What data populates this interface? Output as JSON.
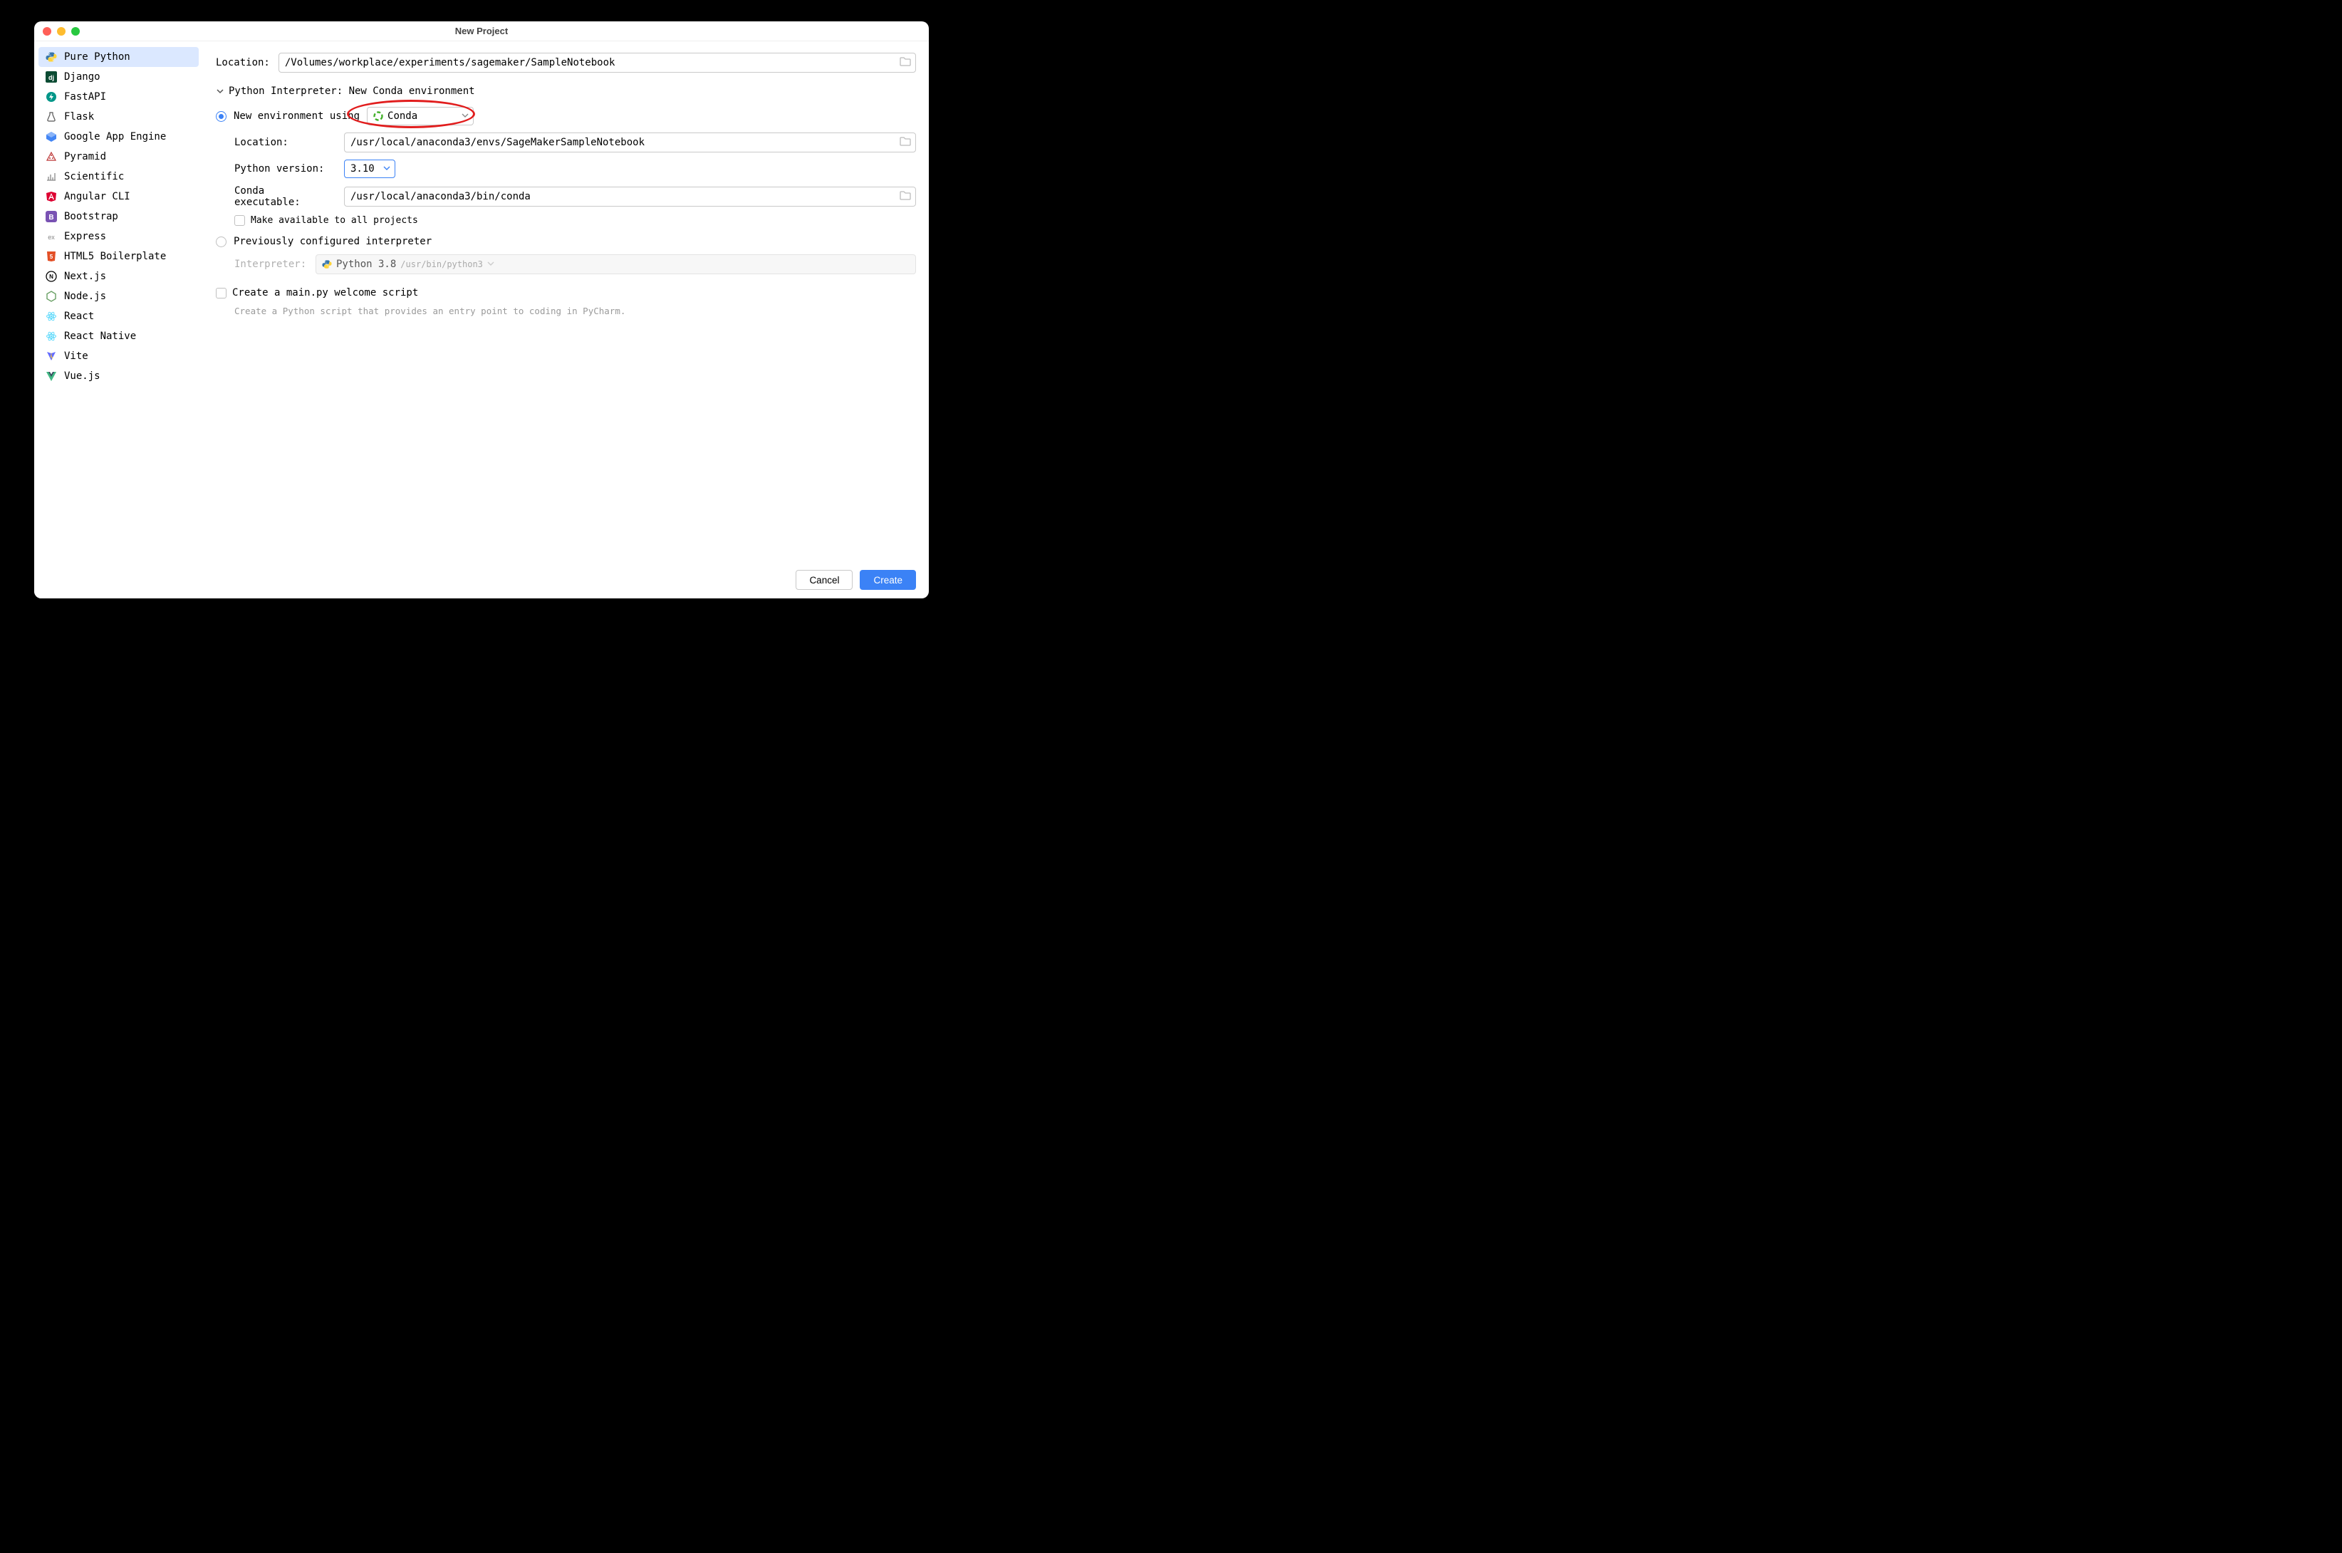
{
  "title": "New Project",
  "sidebar": {
    "items": [
      {
        "label": "Pure Python",
        "icon": "python"
      },
      {
        "label": "Django",
        "icon": "django"
      },
      {
        "label": "FastAPI",
        "icon": "fastapi"
      },
      {
        "label": "Flask",
        "icon": "flask"
      },
      {
        "label": "Google App Engine",
        "icon": "gae"
      },
      {
        "label": "Pyramid",
        "icon": "pyramid"
      },
      {
        "label": "Scientific",
        "icon": "scientific"
      },
      {
        "label": "Angular CLI",
        "icon": "angular"
      },
      {
        "label": "Bootstrap",
        "icon": "bootstrap"
      },
      {
        "label": "Express",
        "icon": "express"
      },
      {
        "label": "HTML5 Boilerplate",
        "icon": "html5"
      },
      {
        "label": "Next.js",
        "icon": "nextjs"
      },
      {
        "label": "Node.js",
        "icon": "nodejs"
      },
      {
        "label": "React",
        "icon": "react"
      },
      {
        "label": "React Native",
        "icon": "react"
      },
      {
        "label": "Vite",
        "icon": "vite"
      },
      {
        "label": "Vue.js",
        "icon": "vue"
      }
    ],
    "selected_index": 0
  },
  "form": {
    "location_label": "Location:",
    "location_value": "/Volumes/workplace/experiments/sagemaker/SampleNotebook",
    "interpreter_header": "Python Interpreter: New Conda environment",
    "new_env_label": "New environment using",
    "env_tool": "Conda",
    "env_location_label": "Location:",
    "env_location_value": "/usr/local/anaconda3/envs/SageMakerSampleNotebook",
    "python_version_label": "Python version:",
    "python_version_value": "3.10",
    "conda_exec_label": "Conda executable:",
    "conda_exec_value": "/usr/local/anaconda3/bin/conda",
    "make_available_label": "Make available to all projects",
    "prev_interp_label": "Previously configured interpreter",
    "interp_label": "Interpreter:",
    "interp_value": "Python 3.8",
    "interp_path": "/usr/bin/python3",
    "create_main_label": "Create a main.py welcome script",
    "create_main_hint": "Create a Python script that provides an entry point to coding in PyCharm."
  },
  "buttons": {
    "cancel": "Cancel",
    "create": "Create"
  }
}
